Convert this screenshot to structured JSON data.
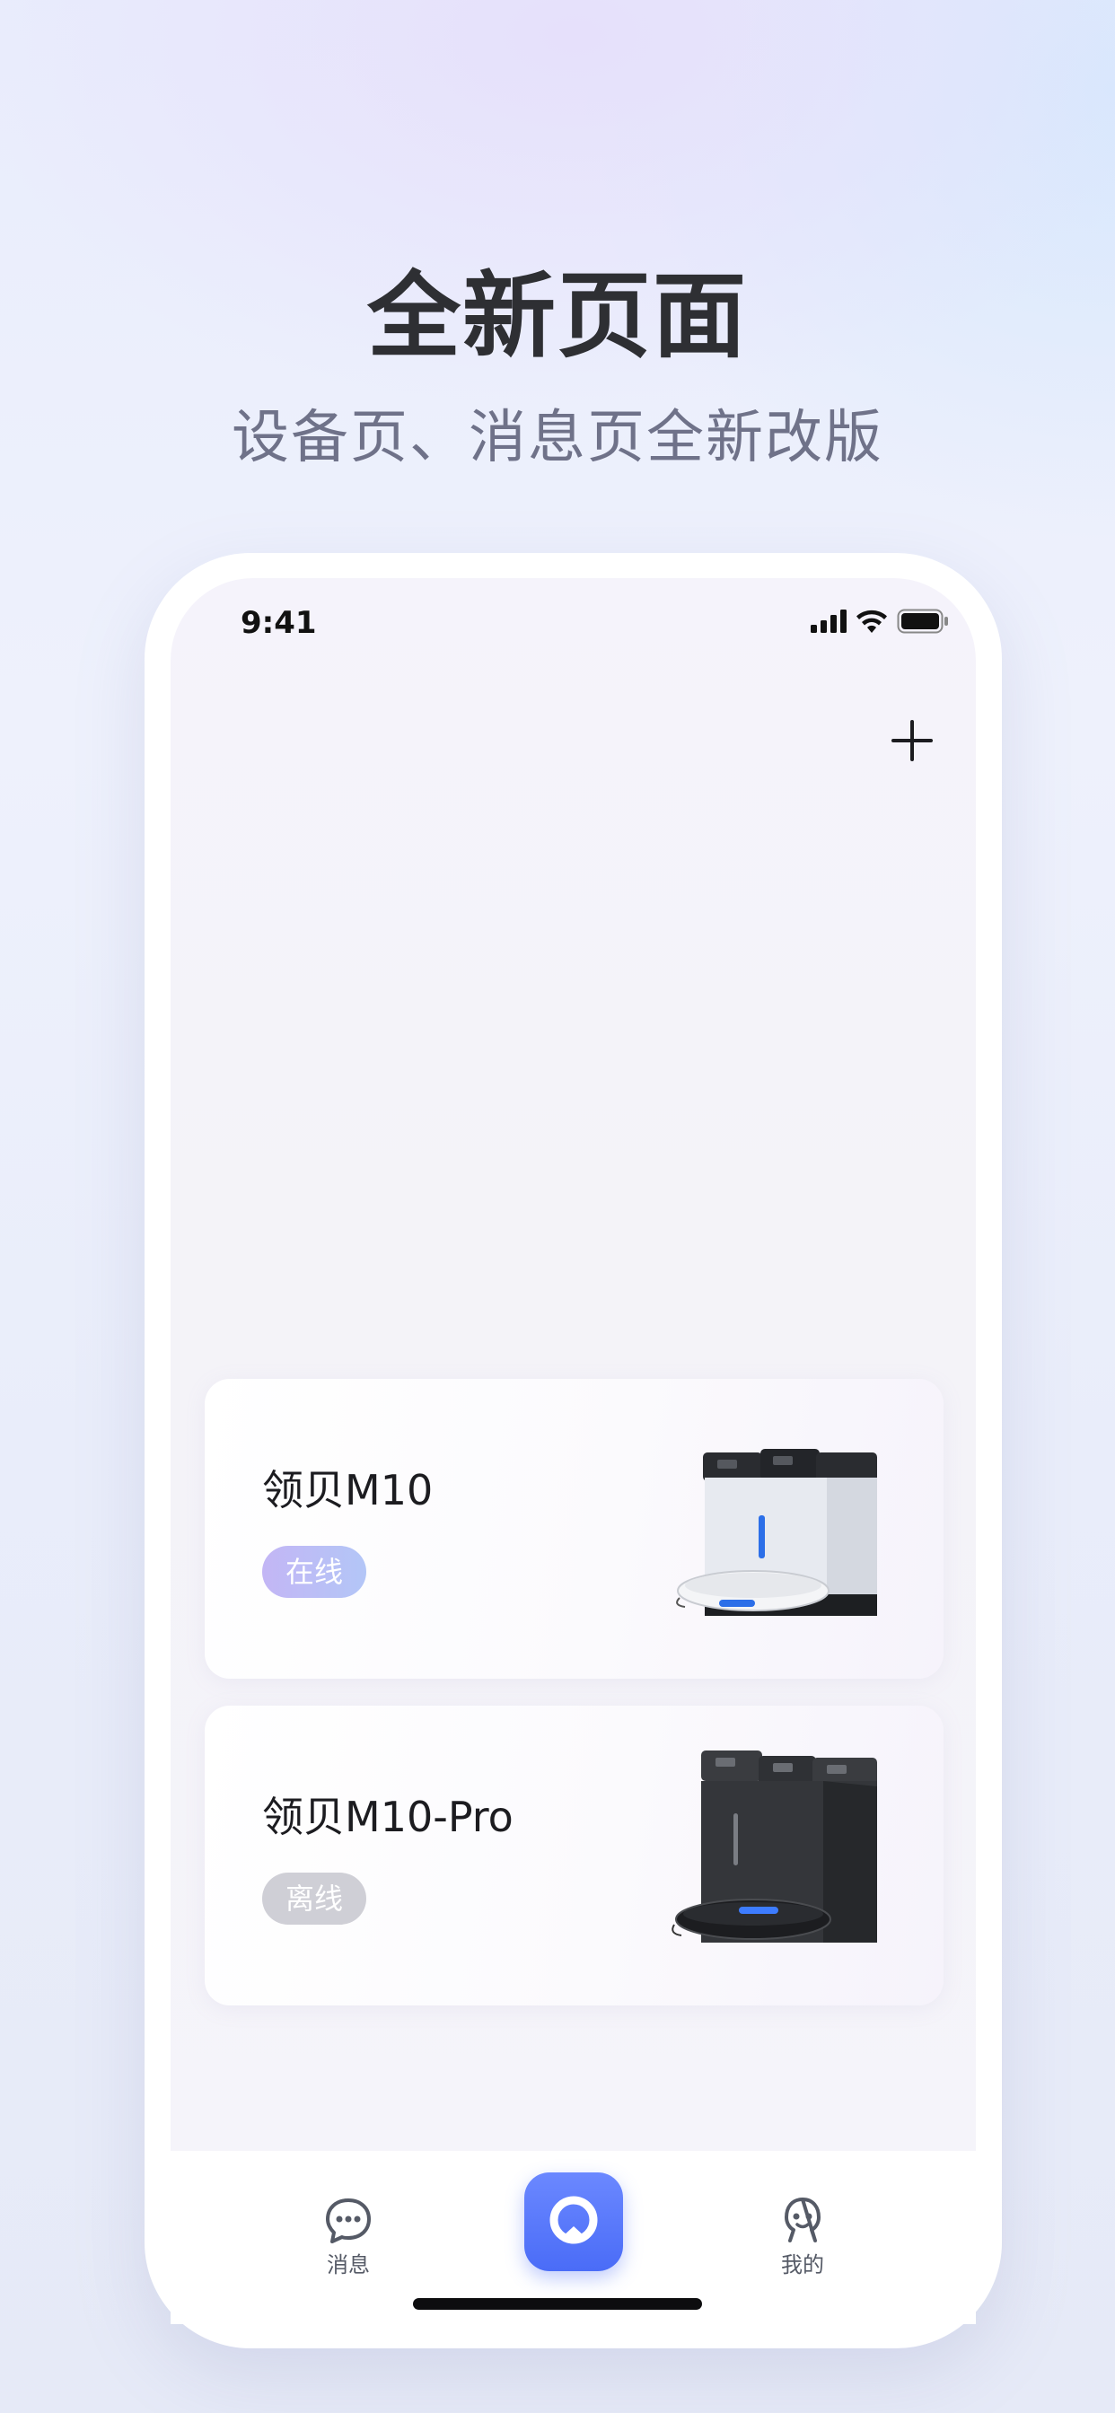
{
  "promo": {
    "headline": "全新页面",
    "subheadline": "设备页、消息页全新改版"
  },
  "status_bar": {
    "time": "9:41",
    "icons": [
      "signal-icon",
      "wifi-icon",
      "battery-icon"
    ]
  },
  "header": {
    "add_icon": "plus-icon"
  },
  "devices": [
    {
      "name": "领贝M10",
      "status": "在线",
      "status_color": "#c3b6f5",
      "image": "white-robot-vacuum-station"
    },
    {
      "name": "领贝M10-Pro",
      "status": "离线",
      "status_color": "#cfcfd6",
      "image": "black-robot-vacuum-station"
    }
  ],
  "tabbar": {
    "messages_label": "消息",
    "messages_icon": "chat-bubble-icon",
    "home_icon": "app-logo-icon",
    "profile_label": "我的",
    "profile_icon": "user-icon",
    "accent_color": "#4a6cf7"
  }
}
